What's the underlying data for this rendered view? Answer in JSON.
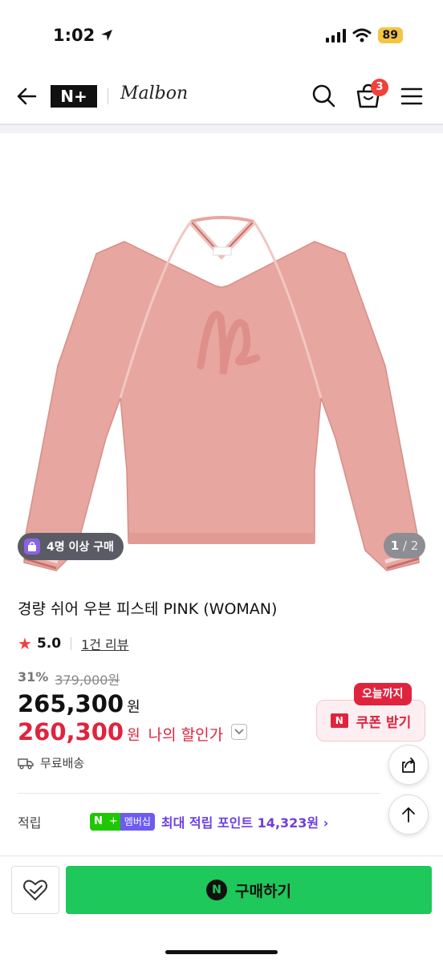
{
  "status_bar": {
    "time": "1:02",
    "battery": "89"
  },
  "header": {
    "logo_text": "N+",
    "brand": "Malbon",
    "cart_count": "3"
  },
  "gallery": {
    "group_buy_badge": "4명 이상 구매",
    "page_current": "1",
    "page_total": "2"
  },
  "product": {
    "title": "경량 쉬어 우븐 피스테 PINK (WOMAN)",
    "rating": "5.0",
    "review_link": "1건 리뷰",
    "discount_pct": "31%",
    "original_price": "379,000원",
    "price": "265,300",
    "price_unit": "원",
    "my_price": "260,300",
    "my_price_unit": "원",
    "my_price_label": "나의 할인가",
    "delivery": "무료배송"
  },
  "coupon": {
    "tag": "오늘까지",
    "logo": "N",
    "label": "쿠폰 받기"
  },
  "points": {
    "label": "적립",
    "membership_n": "N",
    "membership_plus": "+",
    "membership_badge": "멤버십",
    "text": "최대 적립 포인트 14,323원 ›"
  },
  "bottom_bar": {
    "buy_label": "구매하기",
    "buy_logo": "N"
  },
  "colors": {
    "accent_green": "#1ec85a",
    "sale_red": "#e0243e",
    "membership_purple": "#6d3fe0",
    "product_pink": "#e8a6a0"
  }
}
